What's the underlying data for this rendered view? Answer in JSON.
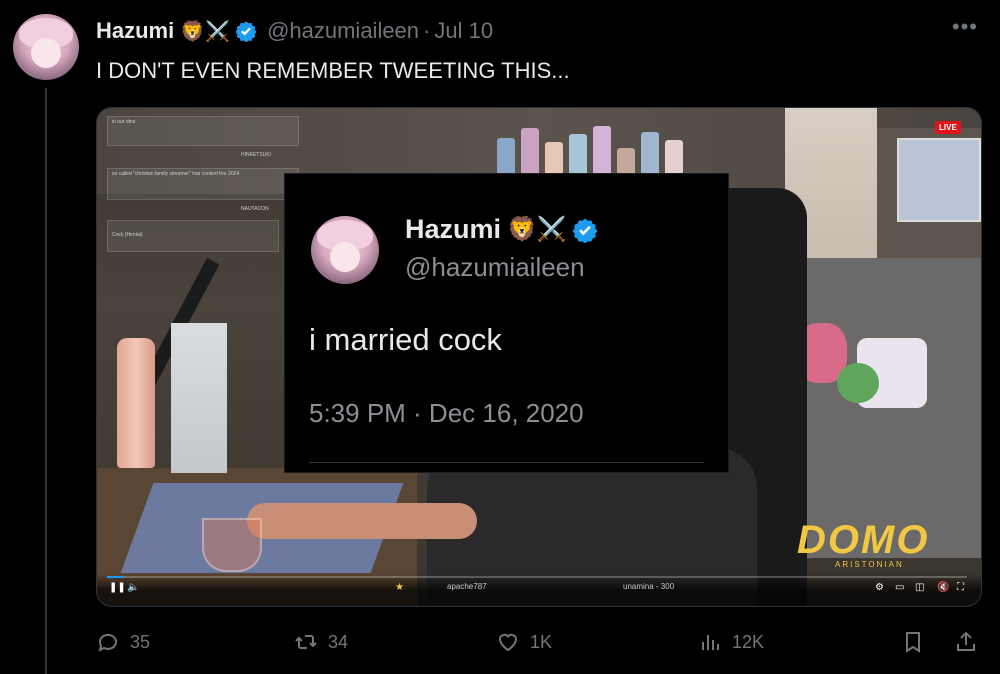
{
  "tweet": {
    "display_name": "Hazumi",
    "name_emoji": "🦁⚔️",
    "handle": "@hazumiaileen",
    "separator": "·",
    "date": "Jul 10",
    "more_icon": "more-horizontal-icon",
    "text": "I DON'T EVEN REMEMBER TWEETING THIS..."
  },
  "media": {
    "embedded_tweet": {
      "display_name": "Hazumi",
      "name_emoji": "🦁⚔️",
      "handle": "@hazumiaileen",
      "text": "i married cock",
      "timestamp": "5:39 PM · Dec 16, 2020"
    },
    "stream": {
      "live_badge": "LIVE",
      "overlay_top": "in our dms",
      "overlay_name1": "HINKETSUKI",
      "overlay_msg": "so called \"christian family streamer\" has cooked live 2024",
      "overlay_name2": "NAUTACON",
      "overlay_chat": "Cock (Hentai)",
      "ticker_user1": "apache787",
      "ticker_user2": "unamina - 300",
      "logo_text": "DOMO",
      "logo_sub": "ARISTONIAN"
    },
    "player": {
      "play_pause_icon": "pause-icon",
      "volume_icon": "volume-icon",
      "progress": 0.02
    }
  },
  "actions": {
    "replies": "35",
    "reposts": "34",
    "likes": "1K",
    "views": "12K",
    "bookmark_icon": "bookmark-icon",
    "share_icon": "share-icon"
  },
  "colors": {
    "background": "#000000",
    "text": "#e7e9ea",
    "muted": "#71767b",
    "verified": "#1d9bf0"
  }
}
